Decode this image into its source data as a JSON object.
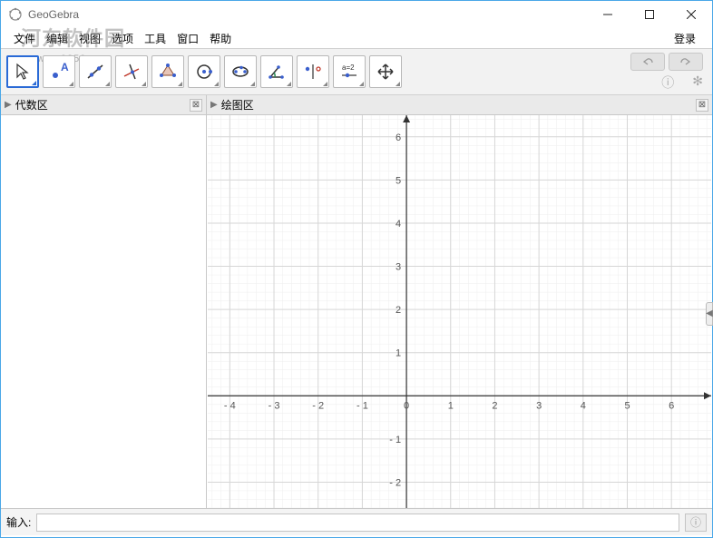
{
  "window": {
    "title": "GeoGebra",
    "login": "登录"
  },
  "menu": {
    "items": [
      "文件",
      "编辑",
      "视图",
      "选项",
      "工具",
      "窗口",
      "帮助"
    ]
  },
  "watermark": {
    "main": "河东软件园",
    "sub": "www.pc0359.cn"
  },
  "toolbar": {
    "tools": [
      {
        "name": "move-tool",
        "selected": true
      },
      {
        "name": "point-tool",
        "selected": false
      },
      {
        "name": "line-tool",
        "selected": false
      },
      {
        "name": "perpendicular-tool",
        "selected": false
      },
      {
        "name": "polygon-tool",
        "selected": false
      },
      {
        "name": "circle-tool",
        "selected": false
      },
      {
        "name": "ellipse-tool",
        "selected": false
      },
      {
        "name": "angle-tool",
        "selected": false
      },
      {
        "name": "reflect-tool",
        "selected": false
      },
      {
        "name": "slider-tool",
        "selected": false,
        "label": "a=2"
      },
      {
        "name": "move-view-tool",
        "selected": false
      }
    ]
  },
  "panels": {
    "algebra": {
      "title": "代数区"
    },
    "graphics": {
      "title": "绘图区"
    }
  },
  "chart_data": {
    "type": "scatter",
    "title": "",
    "xlabel": "",
    "ylabel": "",
    "xlim": [
      -4.5,
      6.9
    ],
    "ylim": [
      -2.6,
      6.5
    ],
    "xticks": [
      -4,
      -3,
      -2,
      -1,
      0,
      1,
      2,
      3,
      4,
      5,
      6
    ],
    "yticks": [
      -2,
      -1,
      1,
      2,
      3,
      4,
      5,
      6
    ],
    "grid": true,
    "series": []
  },
  "input": {
    "label": "输入:",
    "value": "",
    "placeholder": ""
  }
}
